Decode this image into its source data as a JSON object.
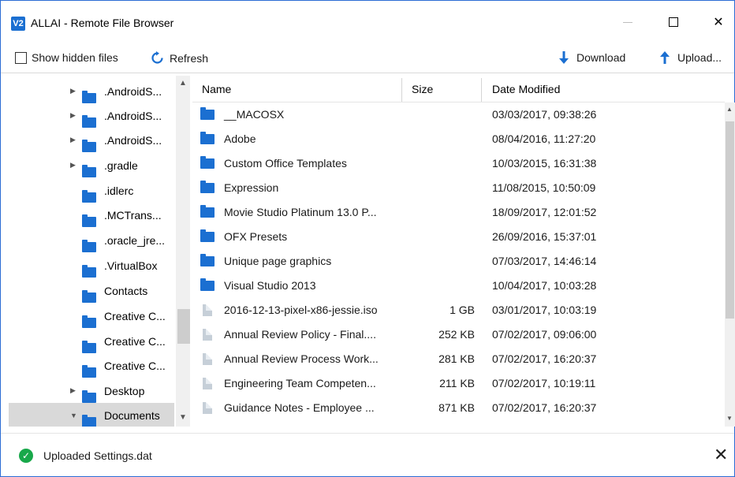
{
  "window": {
    "logo_text": "V2",
    "title": "ALLAI - Remote File Browser",
    "close_glyph": "✕"
  },
  "toolbar": {
    "show_hidden_label": "Show hidden files",
    "refresh_label": "Refresh",
    "download_label": "Download",
    "upload_label": "Upload..."
  },
  "tree": {
    "items": [
      {
        "label": ".AndroidS...",
        "expandable": true
      },
      {
        "label": ".AndroidS...",
        "expandable": true
      },
      {
        "label": ".AndroidS...",
        "expandable": true
      },
      {
        "label": ".gradle",
        "expandable": true
      },
      {
        "label": ".idlerc",
        "expandable": false
      },
      {
        "label": ".MCTrans...",
        "expandable": false
      },
      {
        "label": ".oracle_jre...",
        "expandable": false
      },
      {
        "label": ".VirtualBox",
        "expandable": false
      },
      {
        "label": "Contacts",
        "expandable": false
      },
      {
        "label": "Creative C...",
        "expandable": false
      },
      {
        "label": "Creative C...",
        "expandable": false
      },
      {
        "label": "Creative C...",
        "expandable": false
      },
      {
        "label": "Desktop",
        "expandable": true
      },
      {
        "label": "Documents",
        "expandable": true,
        "expanded": true,
        "selected": true
      }
    ]
  },
  "filelist": {
    "columns": {
      "name": "Name",
      "size": "Size",
      "date": "Date Modified"
    },
    "rows": [
      {
        "type": "folder",
        "name": "__MACOSX",
        "size": "",
        "date": "03/03/2017, 09:38:26"
      },
      {
        "type": "folder",
        "name": "Adobe",
        "size": "",
        "date": "08/04/2016, 11:27:20"
      },
      {
        "type": "folder",
        "name": "Custom Office Templates",
        "size": "",
        "date": "10/03/2015, 16:31:38"
      },
      {
        "type": "folder",
        "name": "Expression",
        "size": "",
        "date": "11/08/2015, 10:50:09"
      },
      {
        "type": "folder",
        "name": "Movie Studio Platinum 13.0 P...",
        "size": "",
        "date": "18/09/2017, 12:01:52"
      },
      {
        "type": "folder",
        "name": "OFX Presets",
        "size": "",
        "date": "26/09/2016, 15:37:01"
      },
      {
        "type": "folder",
        "name": "Unique page graphics",
        "size": "",
        "date": "07/03/2017, 14:46:14"
      },
      {
        "type": "folder",
        "name": "Visual Studio 2013",
        "size": "",
        "date": "10/04/2017, 10:03:28"
      },
      {
        "type": "file",
        "name": "2016-12-13-pixel-x86-jessie.iso",
        "size": "1 GB",
        "date": "03/01/2017, 10:03:19"
      },
      {
        "type": "file",
        "name": "Annual Review Policy - Final....",
        "size": "252 KB",
        "date": "07/02/2017, 09:06:00"
      },
      {
        "type": "file",
        "name": "Annual Review Process Work...",
        "size": "281 KB",
        "date": "07/02/2017, 16:20:37"
      },
      {
        "type": "file",
        "name": "Engineering Team Competen...",
        "size": "211 KB",
        "date": "07/02/2017, 10:19:11"
      },
      {
        "type": "file",
        "name": "Guidance Notes - Employee ...",
        "size": "871 KB",
        "date": "07/02/2017, 16:20:37"
      }
    ]
  },
  "status": {
    "message": "Uploaded Settings.dat",
    "close_glyph": "✕"
  }
}
